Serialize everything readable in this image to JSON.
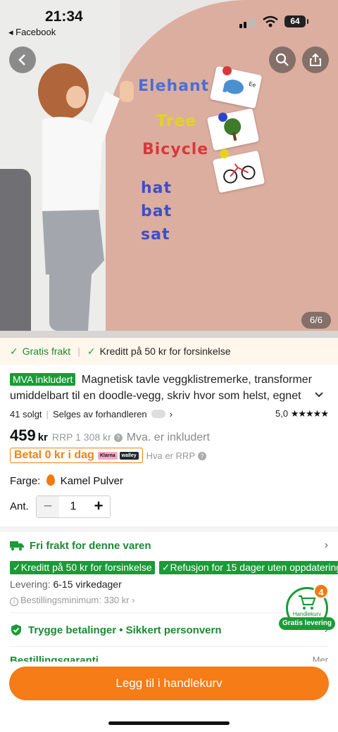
{
  "status": {
    "time": "21:34",
    "back_app": "◂ Facebook",
    "battery": "64"
  },
  "hero": {
    "image_counter": "6/6",
    "words": [
      "Elehant",
      "Tree",
      "Bicycle",
      "hat",
      "bat",
      "sat"
    ],
    "cards": [
      "Elephant",
      "Tree",
      "Bicycle"
    ],
    "card_letters": [
      "Ee",
      "",
      ""
    ]
  },
  "promo": {
    "free_shipping": "Gratis frakt",
    "credit": "Kreditt på 50 kr for forsinkelse"
  },
  "product": {
    "mva_badge": "MVA inkludert",
    "title": "Magnetisk tavle veggklistremerke, transformer umiddelbart til en doodle-vegg, skriv hvor som helst, egnet",
    "sold": "41 solgt",
    "seller": "Selges av forhandleren",
    "rating": "5,0",
    "stars": "★★★★★",
    "price": "459",
    "price_unit": "kr",
    "rrp": "RRP 1 308 kr",
    "mva_note": "Mva. er inkludert",
    "klarna_text": "Betal 0 kr i dag",
    "klarna_logo": "Klarna",
    "walley_logo": "walley",
    "rrp_hint": "Hva er RRP",
    "color_label": "Farge:",
    "color_value": "Kamel Pulver",
    "qty_label": "Ant.",
    "qty": "1",
    "minus": "−",
    "plus": "+"
  },
  "shipping": {
    "free_label": "Fri frakt for denne varen",
    "badge1": "Kreditt på 50 kr for forsinkelse",
    "badge2": "Refusjon for 15 dager uten oppdatering",
    "delivery_label": "Levering:",
    "delivery_value": "6-15 virkedager",
    "min_order": "Bestillingsminimum: 330 kr",
    "secure": "Trygge betalinger • Sikkert personvern",
    "guarantee": "Bestillingsgaranti",
    "more": "Mer"
  },
  "cart": {
    "count": "4",
    "label": "Handlekurv",
    "pill": "Gratis levering"
  },
  "cta": {
    "add_to_cart": "Legg til i handlekurv"
  },
  "colors": {
    "accent": "#f57c16",
    "green": "#1a9b38"
  }
}
